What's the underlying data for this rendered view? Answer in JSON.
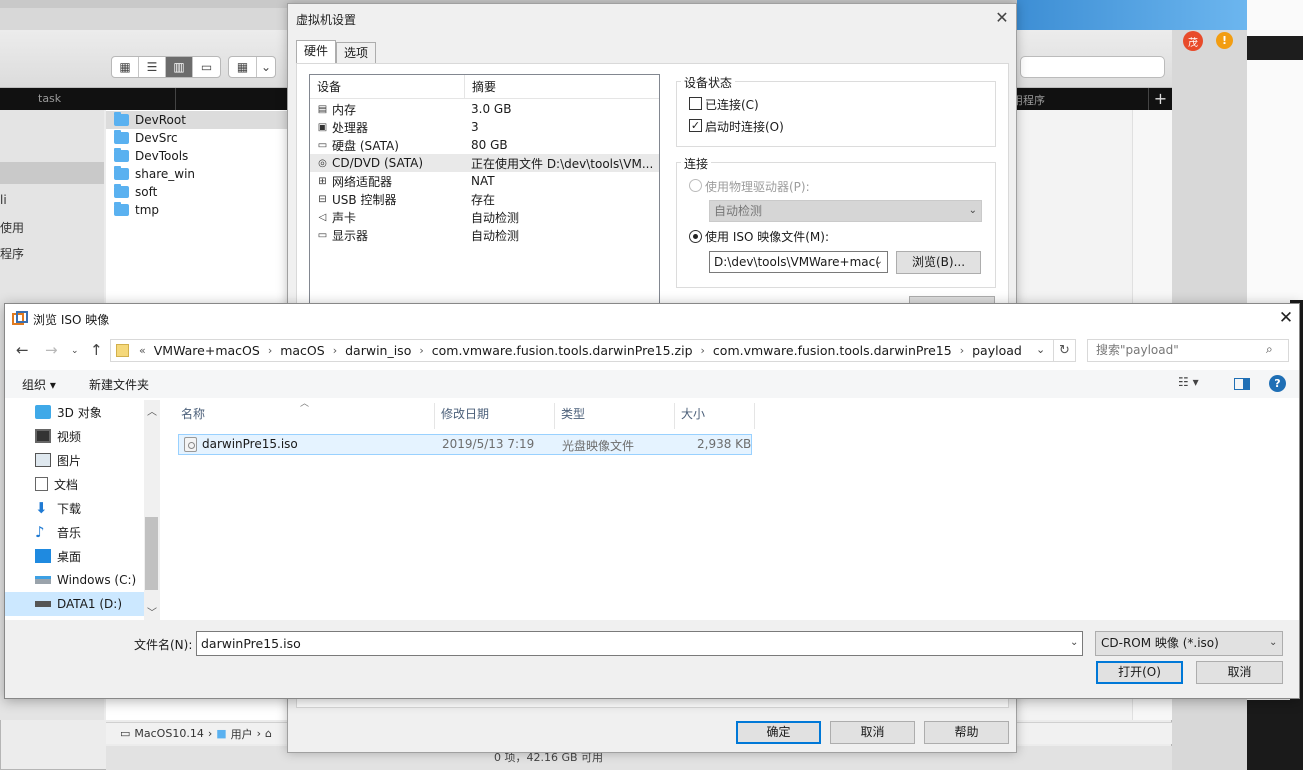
{
  "background": {
    "tabs": [
      "task",
      "用程序"
    ],
    "sidebar_items": [
      "li",
      "使用",
      "程序"
    ],
    "folders": [
      "DevRoot",
      "DevSrc",
      "DevTools",
      "share_win",
      "soft",
      "tmp"
    ],
    "pathbar": [
      "MacOS10.14",
      "用户"
    ],
    "status": "0 项，42.16 GB 可用",
    "avatar": "茂",
    "warn": "!",
    "plus": "+"
  },
  "vm_settings": {
    "title": "虚拟机设置",
    "tabs": [
      "硬件",
      "选项"
    ],
    "columns": [
      "设备",
      "摘要"
    ],
    "devices": [
      {
        "icon": "memory-icon",
        "name": "内存",
        "summary": "3.0 GB"
      },
      {
        "icon": "cpu-icon",
        "name": "处理器",
        "summary": "3"
      },
      {
        "icon": "disk-icon",
        "name": "硬盘 (SATA)",
        "summary": "80 GB"
      },
      {
        "icon": "cd-icon",
        "name": "CD/DVD (SATA)",
        "summary": "正在使用文件 D:\\dev\\tools\\VM..."
      },
      {
        "icon": "network-icon",
        "name": "网络适配器",
        "summary": "NAT"
      },
      {
        "icon": "usb-icon",
        "name": "USB 控制器",
        "summary": "存在"
      },
      {
        "icon": "sound-icon",
        "name": "声卡",
        "summary": "自动检测"
      },
      {
        "icon": "display-icon",
        "name": "显示器",
        "summary": "自动检测"
      }
    ],
    "device_status": {
      "label": "设备状态",
      "connected": "已连接(C)",
      "connect_at_power_on": "启动时连接(O)"
    },
    "connection": {
      "label": "连接",
      "physical_drive": "使用物理驱动器(P):",
      "physical_value": "自动检测",
      "iso_file": "使用 ISO 映像文件(M):",
      "iso_path": "D:\\dev\\tools\\VMWare+mac(",
      "browse": "浏览(B)..."
    },
    "buttons": {
      "ok": "确定",
      "cancel": "取消",
      "help": "帮助"
    }
  },
  "iso_dialog": {
    "title": "浏览 ISO 映像",
    "breadcrumbs": [
      "VMWare+macOS",
      "macOS",
      "darwin_iso",
      "com.vmware.fusion.tools.darwinPre15.zip",
      "com.vmware.fusion.tools.darwinPre15",
      "payload"
    ],
    "search_placeholder": "搜索\"payload\"",
    "organize": "组织 ▾",
    "new_folder": "新建文件夹",
    "nav_items": [
      {
        "icon": "3d-objects-icon",
        "label": "3D 对象"
      },
      {
        "icon": "video-icon",
        "label": "视频"
      },
      {
        "icon": "pictures-icon",
        "label": "图片"
      },
      {
        "icon": "documents-icon",
        "label": "文档"
      },
      {
        "icon": "download-icon",
        "label": "下载"
      },
      {
        "icon": "music-icon",
        "label": "音乐"
      },
      {
        "icon": "desktop-icon",
        "label": "桌面"
      },
      {
        "icon": "drive-c-icon",
        "label": "Windows (C:)"
      },
      {
        "icon": "drive-d-icon",
        "label": "DATA1 (D:)"
      }
    ],
    "columns": [
      "名称",
      "修改日期",
      "类型",
      "大小"
    ],
    "file": {
      "name": "darwinPre15.iso",
      "date": "2019/5/13 7:19",
      "type": "光盘映像文件",
      "size": "2,938 KB"
    },
    "filename_label": "文件名(N):",
    "filename_value": "darwinPre15.iso",
    "filetype": "CD-ROM 映像 (*.iso)",
    "open": "打开(O)",
    "cancel": "取消"
  },
  "colors": {
    "accent": "#0078d7",
    "selection": "#cce8ff",
    "folder": "#5ab1f0"
  }
}
